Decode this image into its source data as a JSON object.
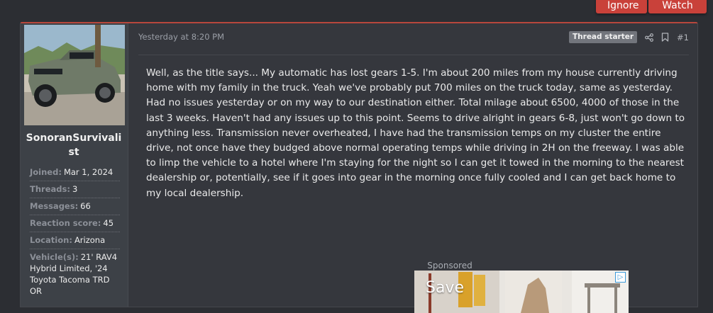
{
  "top_buttons": {
    "ignore": "Ignore",
    "watch": "Watch"
  },
  "user": {
    "username": "SonoranSurvivalist",
    "stats": [
      {
        "label": "Joined:",
        "value": "Mar 1, 2024"
      },
      {
        "label": "Threads:",
        "value": "3"
      },
      {
        "label": "Messages:",
        "value": "66"
      },
      {
        "label": "Reaction score:",
        "value": "45"
      },
      {
        "label": "Location:",
        "value": "Arizona"
      },
      {
        "label": "Vehicle(s):",
        "value": "21' RAV4 Hybrid Limited, '24 Toyota Tacoma TRD OR"
      }
    ]
  },
  "post": {
    "date": "Yesterday at 8:20 PM",
    "badge": "Thread starter",
    "number": "#1",
    "icons": [
      "share-icon",
      "bookmark-icon"
    ],
    "body": "Well, as the title says... My automatic has lost gears 1-5. I'm about 200 miles from my house currently driving home with my family in the truck. Yeah we've probably put 700 miles on the truck today, same as yesterday. Had no issues yesterday or on my way to our destination either. Total milage about 6500, 4000 of those in the last 3 weeks. Haven't had any issues up to this point. Seems to drive alright in gears 6-8, just won't go down to anything less. Transmission never overheated, I have had the transmission temps on my cluster the entire drive, not once have they budged above normal operating temps while driving in 2H on the freeway. I was able to limp the vehicle to a hotel where I'm staying for the night so I can get it towed in the morning to the nearest dealership or, potentially, see if it goes into gear in the morning once fully cooled and I can get back home to my local dealership."
  },
  "ad": {
    "sponsored_label": "Sponsored",
    "headline": "Save"
  },
  "colors": {
    "accent": "#c9413a",
    "background": "#2c2e33",
    "panel": "#35373d"
  }
}
